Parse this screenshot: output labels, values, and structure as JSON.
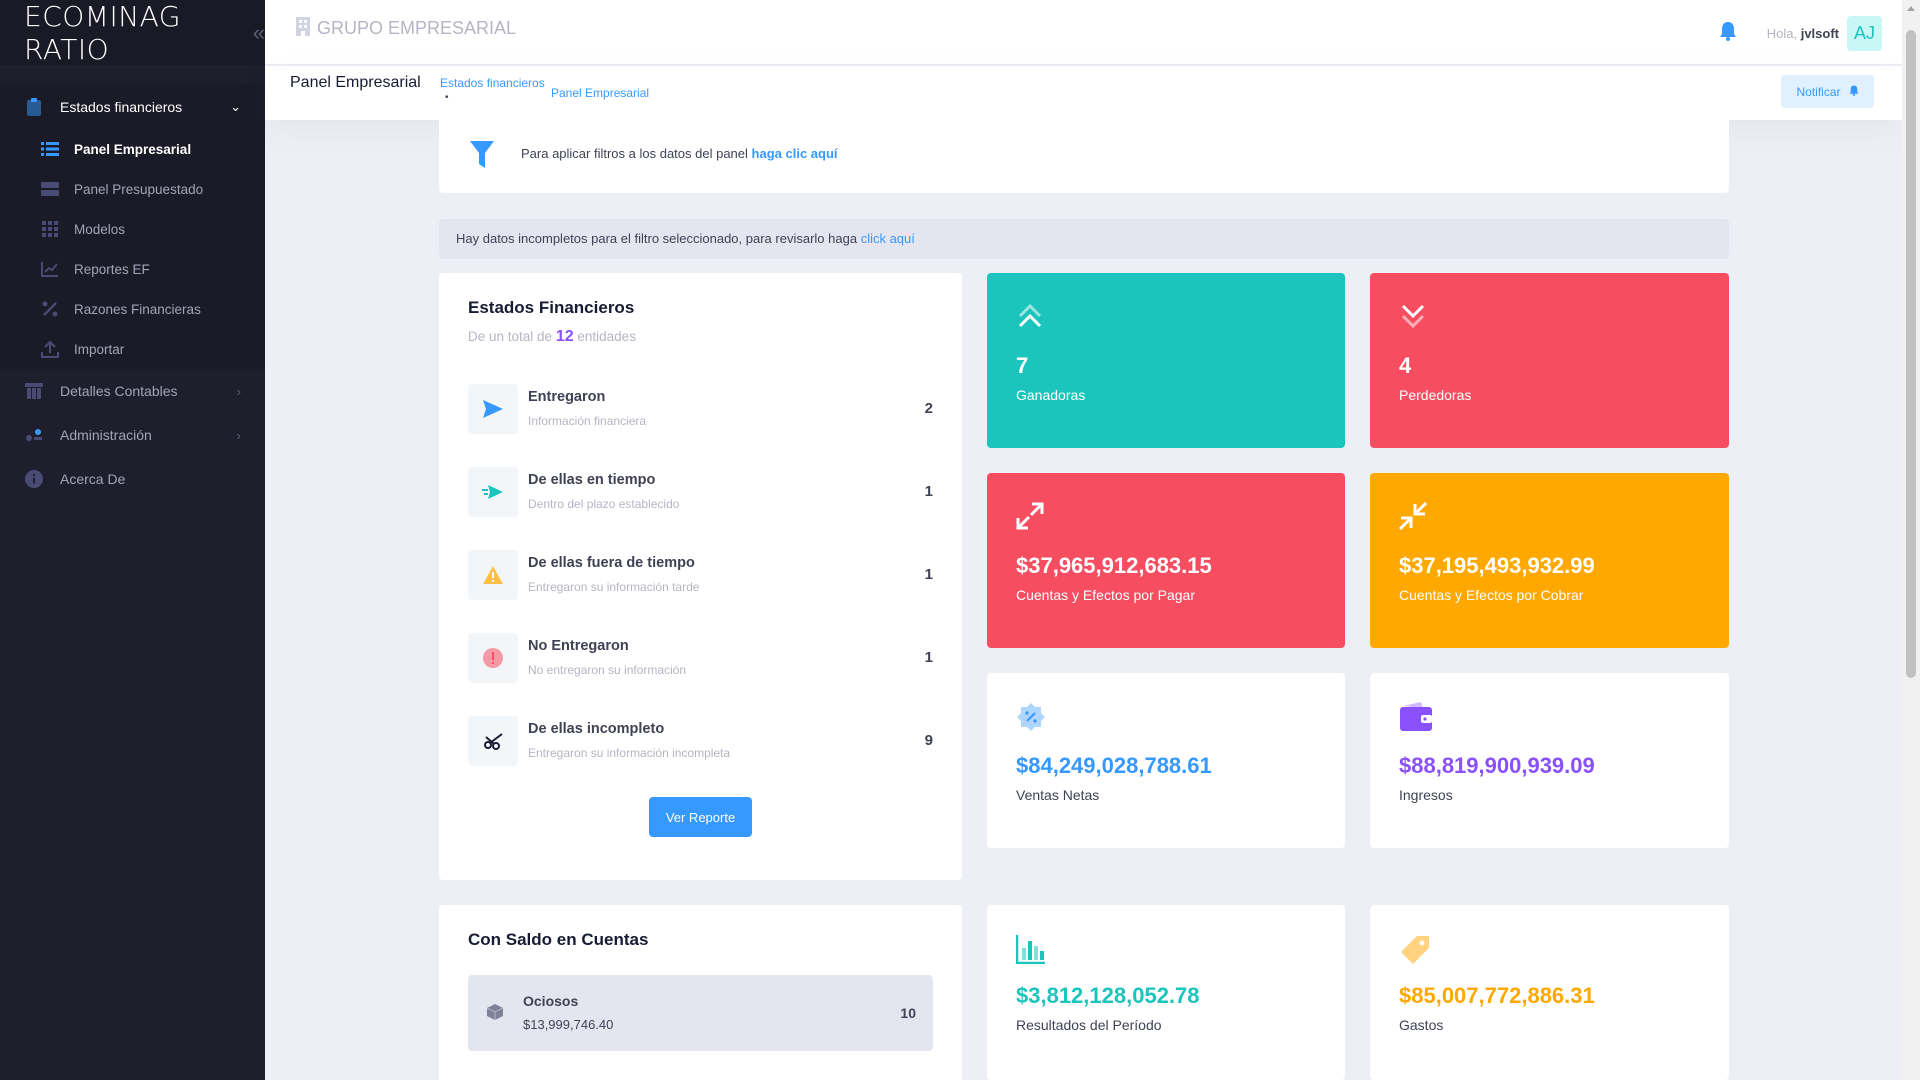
{
  "brand": {
    "name": "ECOMINAG",
    "product": "RATIO",
    "toggle_icon": "double-chevron-left-icon"
  },
  "sidebar": {
    "items": [
      {
        "label": "Estados financieros",
        "icon": "clipboard-icon",
        "open": true,
        "children": [
          {
            "label": "Panel Empresarial",
            "icon": "list-icon",
            "active": true
          },
          {
            "label": "Panel Presupuestado",
            "icon": "layers-icon"
          },
          {
            "label": "Modelos",
            "icon": "grid-icon"
          },
          {
            "label": "Reportes EF",
            "icon": "chart-line-icon"
          },
          {
            "label": "Razones Financieras",
            "icon": "percent-icon"
          },
          {
            "label": "Importar",
            "icon": "upload-icon"
          }
        ]
      },
      {
        "label": "Detalles Contables",
        "icon": "table-icon"
      },
      {
        "label": "Administración",
        "icon": "settings-icon"
      },
      {
        "label": "Acerca De",
        "icon": "info-icon"
      }
    ]
  },
  "header": {
    "org": "GRUPO EMPRESARIAL",
    "hello": "Hola,",
    "user": "jvlsoft",
    "avatar": "AJ"
  },
  "subheader": {
    "title": "Panel Empresarial",
    "crumb1": "Estados financieros",
    "crumb_sep": "•",
    "crumb2": "Panel Empresarial",
    "notify_label": "Notificar"
  },
  "filter": {
    "text": "Para aplicar filtros a los datos del panel",
    "link": "haga clic aquí"
  },
  "alert": {
    "text": "Hay datos incompletos para el filtro seleccionado, para revisarlo haga",
    "link": "click aquí"
  },
  "ef": {
    "title": "Estados Financieros",
    "subtitle_pre": "De un total de",
    "total": "12",
    "subtitle_post": "entidades",
    "rows": [
      {
        "title": "Entregaron",
        "sub": "Información financiera",
        "value": "2",
        "icon": "send-icon"
      },
      {
        "title": "De ellas en tiempo",
        "sub": "Dentro del plazo establecido",
        "value": "1",
        "icon": "send-fast-icon"
      },
      {
        "title": "De ellas fuera de tiempo",
        "sub": "Entregaron su información tarde",
        "value": "1",
        "icon": "warning-icon"
      },
      {
        "title": "No Entregaron",
        "sub": "No entregaron su información",
        "value": "1",
        "icon": "error-icon"
      },
      {
        "title": "De ellas incompleto",
        "sub": "Entregaron su información incompleta",
        "value": "9",
        "icon": "cut-icon"
      }
    ],
    "button": "Ver Reporte"
  },
  "stats": {
    "ganadoras": {
      "value": "7",
      "label": "Ganadoras",
      "icon": "double-chevron-up-icon"
    },
    "perdedoras": {
      "value": "4",
      "label": "Perdedoras",
      "icon": "double-chevron-down-icon"
    },
    "pagar": {
      "value": "$37,965,912,683.15",
      "label": "Cuentas y Efectos por Pagar",
      "icon": "arrows-expand-icon"
    },
    "cobrar": {
      "value": "$37,195,493,932.99",
      "label": "Cuentas y Efectos por Cobrar",
      "icon": "arrows-collapse-icon"
    },
    "ventas": {
      "value": "$84,249,028,788.61",
      "label": "Ventas Netas",
      "icon": "discount-badge-icon"
    },
    "ingresos": {
      "value": "$88,819,900,939.09",
      "label": "Ingresos",
      "icon": "wallet-icon"
    },
    "resultados": {
      "value": "$3,812,128,052.78",
      "label": "Resultados del Período",
      "icon": "bar-chart-icon"
    },
    "gastos": {
      "value": "$85,007,772,886.31",
      "label": "Gastos",
      "icon": "price-tag-icon"
    }
  },
  "saldo": {
    "title": "Con Saldo en Cuentas",
    "rows": [
      {
        "title": "Ociosos",
        "sub": "$13,999,746.40",
        "value": "10",
        "icon": "box-icon"
      }
    ]
  },
  "colors": {
    "primary": "#3699ff",
    "teal": "#1bc5bd",
    "red": "#f64e60",
    "orange": "#ffa800",
    "purple": "#8950fc",
    "sidebar": "#1e1e2d"
  }
}
